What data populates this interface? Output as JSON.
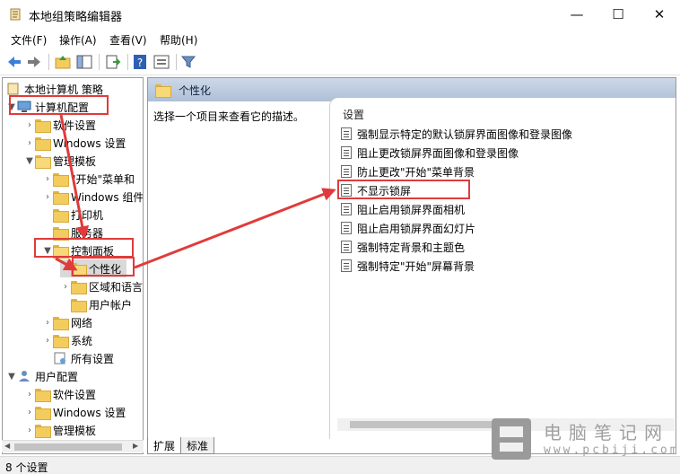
{
  "window": {
    "title": "本地组策略编辑器",
    "minimize": "—",
    "maximize": "☐",
    "close": "✕"
  },
  "menu": [
    "文件(F)",
    "操作(A)",
    "查看(V)",
    "帮助(H)"
  ],
  "tree": {
    "root": "本地计算机 策略",
    "items": [
      {
        "label": "计算机配置"
      },
      {
        "label": "软件设置"
      },
      {
        "label": "Windows 设置"
      },
      {
        "label": "管理模板"
      },
      {
        "label": "\"开始\"菜单和"
      },
      {
        "label": "Windows 组件"
      },
      {
        "label": "打印机"
      },
      {
        "label": "服务器"
      },
      {
        "label": "控制面板"
      },
      {
        "label": "个性化"
      },
      {
        "label": "区域和语言"
      },
      {
        "label": "用户帐户"
      },
      {
        "label": "网络"
      },
      {
        "label": "系统"
      },
      {
        "label": "所有设置"
      },
      {
        "label": "用户配置"
      },
      {
        "label": "软件设置"
      },
      {
        "label": "Windows 设置"
      },
      {
        "label": "管理模板"
      }
    ]
  },
  "right": {
    "header": "个性化",
    "description": "选择一个项目来查看它的描述。",
    "column_header": "设置",
    "policies": [
      "强制显示特定的默认锁屏界面图像和登录图像",
      "阻止更改锁屏界面图像和登录图像",
      "防止更改\"开始\"菜单背景",
      "不显示锁屏",
      "阻止启用锁屏界面相机",
      "阻止启用锁屏界面幻灯片",
      "强制特定背景和主题色",
      "强制特定\"开始\"屏幕背景"
    ]
  },
  "tabs": [
    "扩展",
    "标准"
  ],
  "status": "8 个设置",
  "watermark": {
    "cn": "电脑笔记网",
    "url": "www.pcbiji.com"
  },
  "colors": {
    "annotation": "#e03b3b",
    "header_blue": "#aebfd6"
  }
}
